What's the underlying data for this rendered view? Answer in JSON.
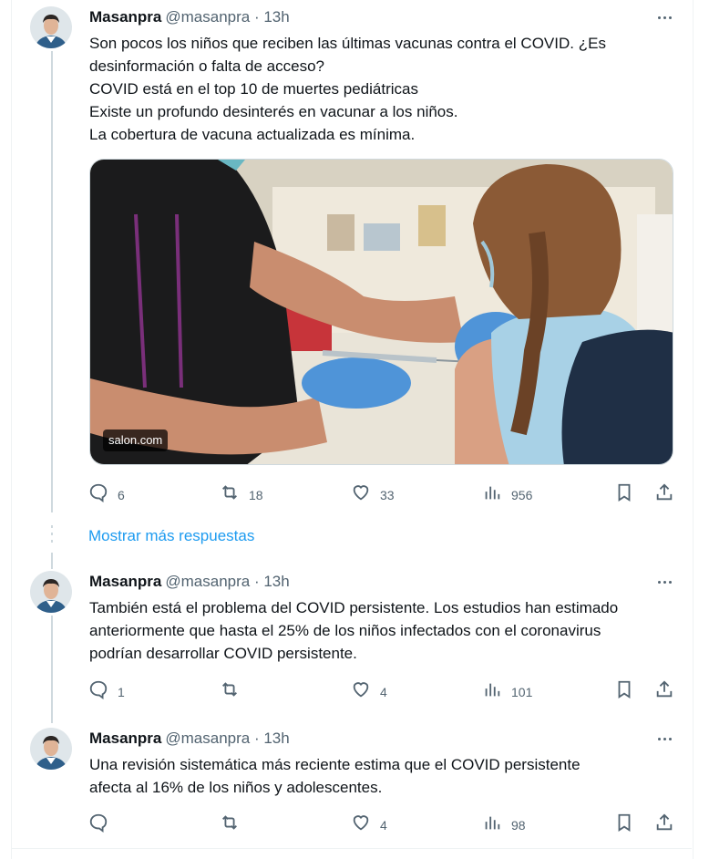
{
  "colors": {
    "accent": "#1d9bf0",
    "muted": "#536471",
    "text": "#0f1419",
    "border": "#cfd9de"
  },
  "tweets": [
    {
      "name": "Masanpra",
      "handle": "@masanpra",
      "time": "· 13h",
      "lines": [
        "Son pocos los niños que reciben las últimas vacunas contra el COVID. ¿Es",
        "desinformación o falta de acceso?",
        "COVID está en el top 10 de muertes pediátricas",
        "Existe un profundo desinterés en vacunar a los niños.",
        "La cobertura de vacuna actualizada es mínima."
      ],
      "media_source": "salon.com",
      "replies": "6",
      "retweets": "18",
      "likes": "33",
      "views": "956"
    },
    {
      "name": "Masanpra",
      "handle": "@masanpra",
      "time": "· 13h",
      "lines": [
        "También está el problema del COVID persistente. Los estudios han estimado",
        "anteriormente que hasta el 25% de los niños infectados con el coronavirus",
        "podrían desarrollar COVID persistente."
      ],
      "replies": "1",
      "retweets": "",
      "likes": "4",
      "views": "101"
    },
    {
      "name": "Masanpra",
      "handle": "@masanpra",
      "time": "· 13h",
      "lines": [
        "Una revisión sistemática más reciente estima que el COVID persistente",
        "afecta al 16% de los niños y adolescentes."
      ],
      "replies": "",
      "retweets": "",
      "likes": "4",
      "views": "98"
    }
  ],
  "show_more_label": "Mostrar más respuestas",
  "icons": [
    "reply-icon",
    "retweet-icon",
    "like-icon",
    "views-icon",
    "bookmark-icon",
    "share-icon",
    "more-icon"
  ]
}
